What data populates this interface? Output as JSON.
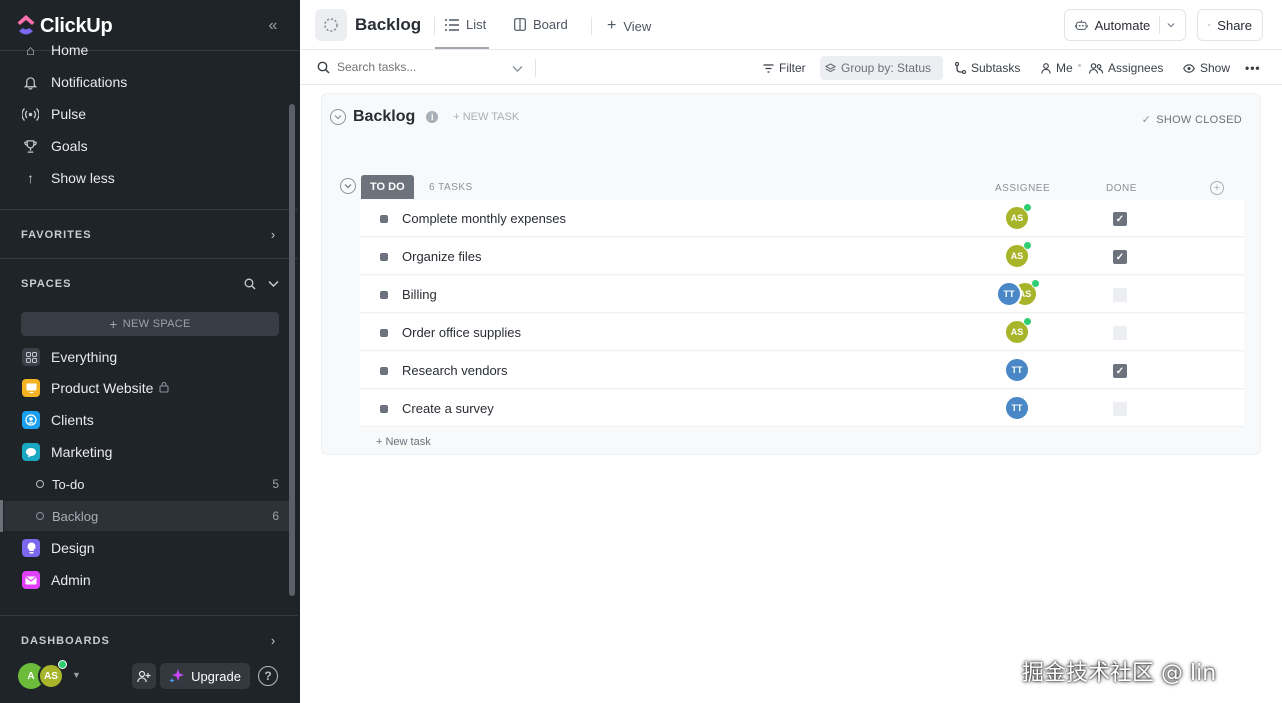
{
  "app": {
    "name": "ClickUp"
  },
  "sidebar": {
    "nav": [
      {
        "label": "Home",
        "icon": "home-icon"
      },
      {
        "label": "Notifications",
        "icon": "bell-icon"
      },
      {
        "label": "Pulse",
        "icon": "pulse-icon"
      },
      {
        "label": "Goals",
        "icon": "trophy-icon"
      },
      {
        "label": "Show less",
        "icon": "arrow-up-icon"
      }
    ],
    "favorites_title": "FAVORITES",
    "spaces_title": "SPACES",
    "new_space_label": "NEW SPACE",
    "spaces": [
      {
        "label": "Everything",
        "color": "#3a4048"
      },
      {
        "label": "Product Website",
        "color": "#f5b324"
      },
      {
        "label": "Clients",
        "color": "#1b9ff0"
      },
      {
        "label": "Marketing",
        "color": "#1aa7c4"
      }
    ],
    "lists": [
      {
        "label": "To-do",
        "count": "5"
      },
      {
        "label": "Backlog",
        "count": "6"
      }
    ],
    "spaces_more": [
      {
        "label": "Design",
        "color": "#7b68ee"
      },
      {
        "label": "Admin",
        "color": "#e040fb"
      }
    ],
    "dashboards_title": "DASHBOARDS",
    "user_avatars": [
      "A",
      "AS"
    ],
    "upgrade_label": "Upgrade",
    "help_label": "?"
  },
  "header": {
    "title": "Backlog",
    "tabs": [
      {
        "label": "List"
      },
      {
        "label": "Board"
      }
    ],
    "add_view_label": "View",
    "automate_label": "Automate",
    "share_label": "Share"
  },
  "toolbar": {
    "search_placeholder": "Search tasks...",
    "filter_label": "Filter",
    "group_by_label": "Group by: Status",
    "subtasks_label": "Subtasks",
    "me_label": "Me",
    "assignees_label": "Assignees",
    "show_label": "Show"
  },
  "list": {
    "title": "Backlog",
    "new_task_header": "+ NEW TASK",
    "show_closed_label": "SHOW CLOSED",
    "group": {
      "status": "TO DO",
      "count_label": "6 TASKS",
      "columns": {
        "assignee": "ASSIGNEE",
        "done": "DONE"
      }
    },
    "tasks": [
      {
        "name": "Complete monthly expenses",
        "assignees": [
          "AS"
        ],
        "done": true
      },
      {
        "name": "Organize files",
        "assignees": [
          "AS"
        ],
        "done": true
      },
      {
        "name": "Billing",
        "assignees": [
          "TT",
          "AS"
        ],
        "done": false
      },
      {
        "name": "Order office supplies",
        "assignees": [
          "AS"
        ],
        "done": false
      },
      {
        "name": "Research vendors",
        "assignees": [
          "TT"
        ],
        "done": true
      },
      {
        "name": "Create a survey",
        "assignees": [
          "TT"
        ],
        "done": false
      }
    ],
    "new_task_row": "+ New task"
  },
  "colors": {
    "as_avatar": "#a8b52a",
    "tt_avatar": "#4a87c6",
    "user_a_avatar": "#6dbb3a"
  },
  "watermark": "掘金技术社区 @ lin"
}
